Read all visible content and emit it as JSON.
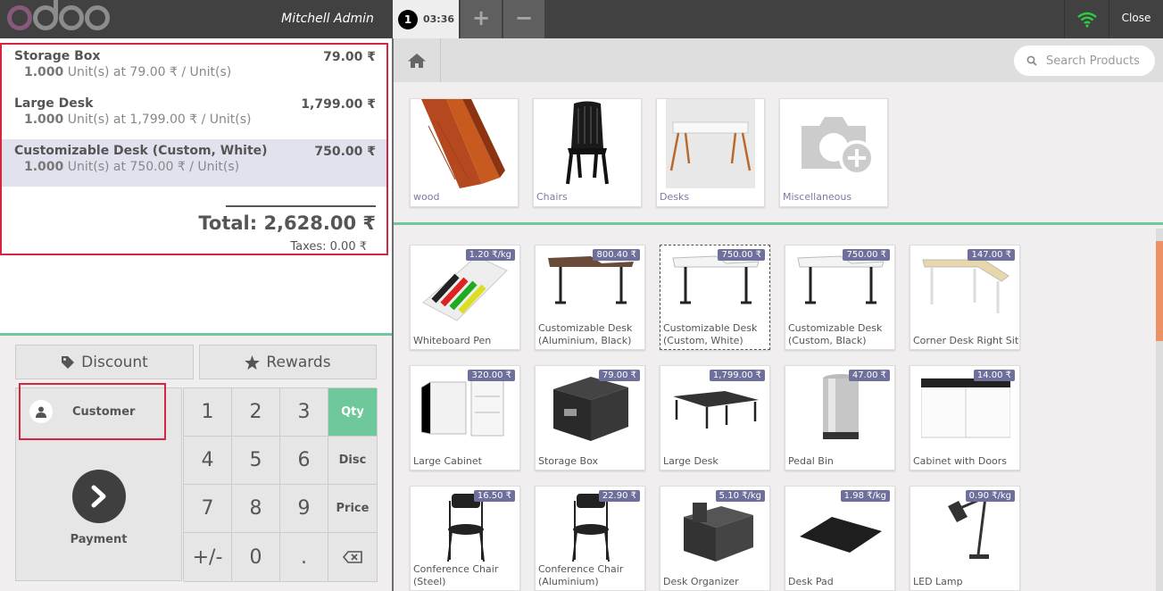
{
  "header": {
    "user_name": "Mitchell Admin",
    "order_number": "1",
    "order_time": "03:36",
    "add_label": "+",
    "remove_label": "−",
    "close_label": "Close"
  },
  "order": {
    "lines": [
      {
        "name": "Storage Box",
        "price": "79.00 ₹",
        "qty": "1.000",
        "info": "Unit(s) at 79.00 ₹ / Unit(s)"
      },
      {
        "name": "Large Desk",
        "price": "1,799.00 ₹",
        "qty": "1.000",
        "info": "Unit(s) at 1,799.00 ₹ / Unit(s)"
      },
      {
        "name": "Customizable Desk (Custom, White)",
        "price": "750.00 ₹",
        "qty": "1.000",
        "info": "Unit(s) at 750.00 ₹ / Unit(s)"
      }
    ],
    "total": "Total: 2,628.00 ₹",
    "taxes": "Taxes: 0.00 ₹"
  },
  "controls": {
    "discount_label": "Discount",
    "rewards_label": "Rewards",
    "customer_label": "Customer",
    "payment_label": "Payment"
  },
  "numpad": {
    "keys": [
      "1",
      "2",
      "3",
      "Qty",
      "4",
      "5",
      "6",
      "Disc",
      "7",
      "8",
      "9",
      "Price",
      "+/-",
      "0",
      "."
    ],
    "active_mode": "Qty"
  },
  "search": {
    "placeholder": "Search Products"
  },
  "categories": [
    {
      "label": "wood"
    },
    {
      "label": "Chairs"
    },
    {
      "label": "Desks"
    },
    {
      "label": "Miscellaneous"
    }
  ],
  "products": [
    {
      "name": "Whiteboard Pen",
      "price": "1.20 ₹/kg"
    },
    {
      "name": "Customizable Desk (Aluminium, Black)",
      "price": "800.40 ₹"
    },
    {
      "name": "Customizable Desk (Custom, White)",
      "price": "750.00 ₹"
    },
    {
      "name": "Customizable Desk (Custom, Black)",
      "price": "750.00 ₹"
    },
    {
      "name": "Corner Desk Right Sit",
      "price": "147.00 ₹"
    },
    {
      "name": "Large Cabinet",
      "price": "320.00 ₹"
    },
    {
      "name": "Storage Box",
      "price": "79.00 ₹"
    },
    {
      "name": "Large Desk",
      "price": "1,799.00 ₹"
    },
    {
      "name": "Pedal Bin",
      "price": "47.00 ₹"
    },
    {
      "name": "Cabinet with Doors",
      "price": "14.00 ₹"
    },
    {
      "name": "Conference Chair (Steel)",
      "price": "16.50 ₹"
    },
    {
      "name": "Conference Chair (Aluminium)",
      "price": "22.90 ₹"
    },
    {
      "name": "Desk Organizer",
      "price": "5.10 ₹/kg"
    },
    {
      "name": "Desk Pad",
      "price": "1.98 ₹/kg"
    },
    {
      "name": "LED Lamp",
      "price": "0.90 ₹/kg"
    }
  ],
  "colors": {
    "accent": "#6ec89b",
    "brand": "#875a7b",
    "highlight": "#d6263f"
  }
}
